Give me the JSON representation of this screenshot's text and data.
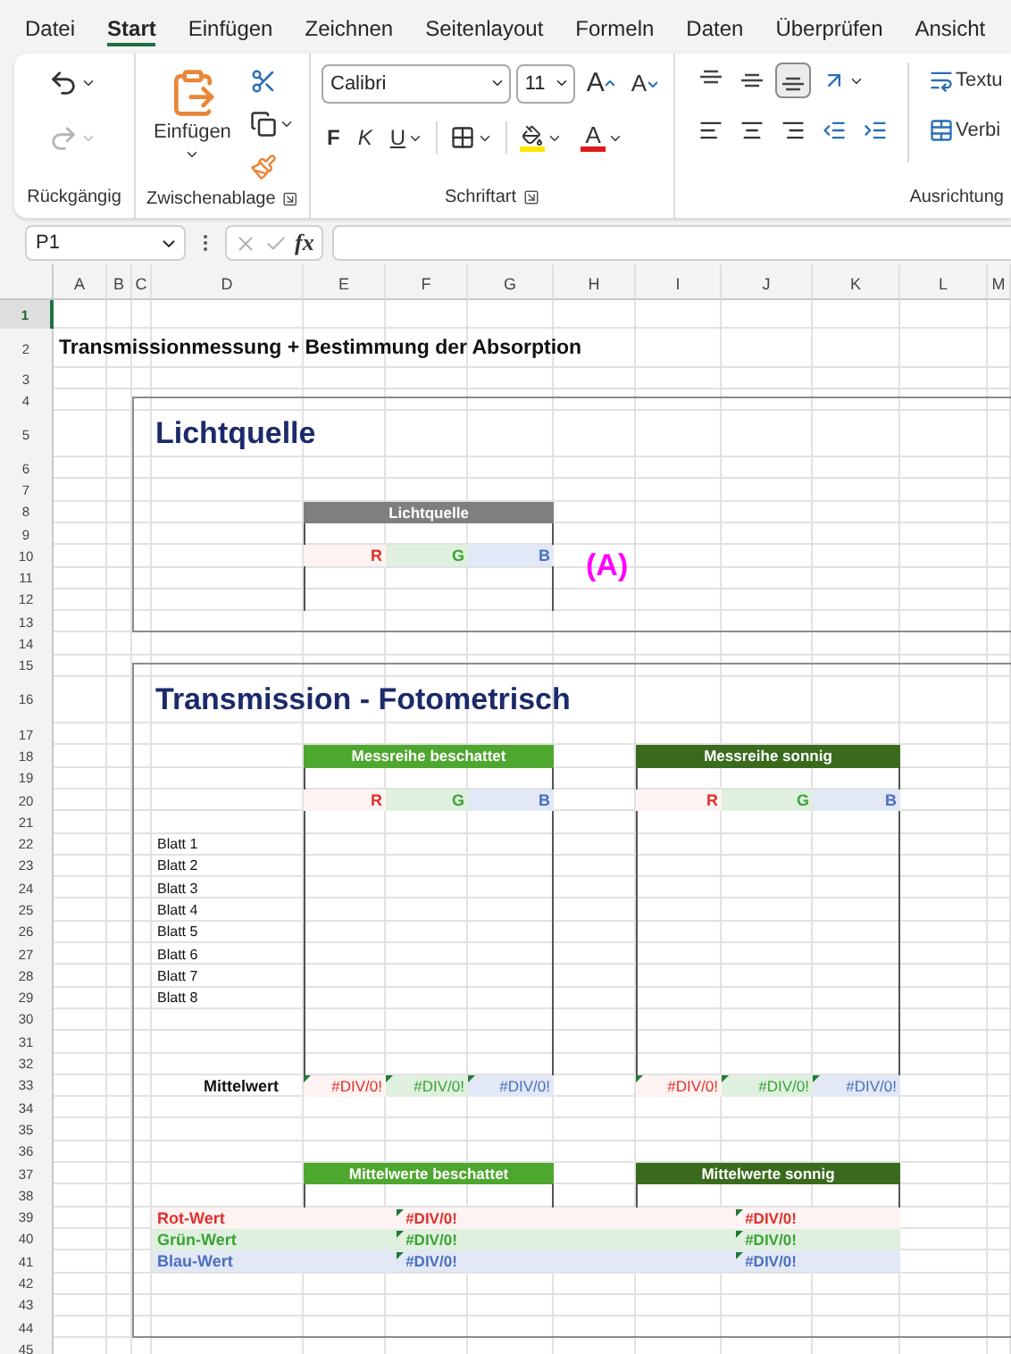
{
  "menu": [
    {
      "label": "Datei",
      "selected": false
    },
    {
      "label": "Start",
      "selected": true
    },
    {
      "label": "Einfügen",
      "selected": false
    },
    {
      "label": "Zeichnen",
      "selected": false
    },
    {
      "label": "Seitenlayout",
      "selected": false
    },
    {
      "label": "Formeln",
      "selected": false
    },
    {
      "label": "Daten",
      "selected": false
    },
    {
      "label": "Überprüfen",
      "selected": false
    },
    {
      "label": "Ansicht",
      "selected": false
    }
  ],
  "ribbon": {
    "redo_disabled": true,
    "paste_label": "Einfügen",
    "font_name": "Calibri",
    "font_size": "11",
    "grow_font": "A",
    "shrink_font": "A",
    "bold": "F",
    "italic": "K",
    "underline": "U",
    "font_color": "A",
    "wrap_text": "Textu",
    "merge": "Verbi",
    "vertical_align": [
      {
        "kind": "top",
        "selected": false
      },
      {
        "kind": "middle",
        "selected": false
      },
      {
        "kind": "bottom",
        "selected": true
      }
    ],
    "groups": [
      {
        "label": "Rückgängig",
        "launcher": false
      },
      {
        "label": "Zwischenablage",
        "launcher": true
      },
      {
        "label": "Schriftart",
        "launcher": true
      },
      {
        "label": "Ausrichtung",
        "launcher": false
      }
    ]
  },
  "formula_bar": {
    "name_box": "P1",
    "function_label": "fx"
  },
  "sheet": {
    "columns": [
      "A",
      "B",
      "C",
      "D",
      "E",
      "F",
      "G",
      "H",
      "I",
      "J",
      "K",
      "L",
      "M"
    ],
    "rows": [
      {
        "label": "1",
        "selected": true
      },
      {
        "label": "2",
        "selected": false
      },
      {
        "label": "3",
        "selected": false
      },
      {
        "label": "4",
        "selected": false
      },
      {
        "label": "5",
        "selected": false
      },
      {
        "label": "6",
        "selected": false
      },
      {
        "label": "7",
        "selected": false
      },
      {
        "label": "8",
        "selected": false
      },
      {
        "label": "9",
        "selected": false
      },
      {
        "label": "10",
        "selected": false
      },
      {
        "label": "11",
        "selected": false
      },
      {
        "label": "12",
        "selected": false
      },
      {
        "label": "13",
        "selected": false
      },
      {
        "label": "14",
        "selected": false
      },
      {
        "label": "15",
        "selected": false
      },
      {
        "label": "16",
        "selected": false
      },
      {
        "label": "17",
        "selected": false
      },
      {
        "label": "18",
        "selected": false
      },
      {
        "label": "19",
        "selected": false
      },
      {
        "label": "20",
        "selected": false
      },
      {
        "label": "21",
        "selected": false
      },
      {
        "label": "22",
        "selected": false
      },
      {
        "label": "23",
        "selected": false
      },
      {
        "label": "24",
        "selected": false
      },
      {
        "label": "25",
        "selected": false
      },
      {
        "label": "26",
        "selected": false
      },
      {
        "label": "27",
        "selected": false
      },
      {
        "label": "28",
        "selected": false
      },
      {
        "label": "29",
        "selected": false
      },
      {
        "label": "30",
        "selected": false
      },
      {
        "label": "31",
        "selected": false
      },
      {
        "label": "32",
        "selected": false
      },
      {
        "label": "33",
        "selected": false
      },
      {
        "label": "34",
        "selected": false
      },
      {
        "label": "35",
        "selected": false
      },
      {
        "label": "36",
        "selected": false
      },
      {
        "label": "37",
        "selected": false
      },
      {
        "label": "38",
        "selected": false
      },
      {
        "label": "39",
        "selected": false
      },
      {
        "label": "40",
        "selected": false
      },
      {
        "label": "41",
        "selected": false
      },
      {
        "label": "42",
        "selected": false
      },
      {
        "label": "43",
        "selected": false
      },
      {
        "label": "44",
        "selected": false
      },
      {
        "label": "45",
        "selected": false
      }
    ],
    "title": "Transmissionmessung +  Bestimmung der Absorption",
    "light_panel": {
      "heading": "Lichtquelle",
      "table": {
        "header": "Lichtquelle",
        "color": "#7f7f7f"
      },
      "marker": "(A)",
      "channels": [
        {
          "label": "R",
          "color": "#e0302a"
        },
        {
          "label": "G",
          "color": "#3aa335"
        },
        {
          "label": "B",
          "color": "#4a6fc0"
        }
      ]
    },
    "transmission_panel": {
      "heading": "Transmission - Fotometrisch",
      "sheets": [
        "Blatt 1",
        "Blatt 2",
        "Blatt 3",
        "Blatt 4",
        "Blatt 5",
        "Blatt 6",
        "Blatt 7",
        "Blatt 8"
      ],
      "mean_label": "Mittelwert",
      "series": [
        {
          "header": "Messreihe beschattet",
          "color": "#4ea72e",
          "channels": [
            {
              "label": "R",
              "color": "#e0302a"
            },
            {
              "label": "G",
              "color": "#3aa335"
            },
            {
              "label": "B",
              "color": "#4a6fc0"
            }
          ],
          "mean": [
            {
              "text": "#DIV/0!",
              "flagged": true
            },
            {
              "text": "#DIV/0!",
              "flagged": true
            },
            {
              "text": "#DIV/0!",
              "flagged": true
            }
          ]
        },
        {
          "header": "Messreihe sonnig",
          "color": "#3a6b1d",
          "channels": [
            {
              "label": "R",
              "color": "#e0302a"
            },
            {
              "label": "G",
              "color": "#3aa335"
            },
            {
              "label": "B",
              "color": "#4a6fc0"
            }
          ],
          "mean": [
            {
              "text": "#DIV/0!",
              "flagged": true
            },
            {
              "text": "#DIV/0!",
              "flagged": true
            },
            {
              "text": "#DIV/0!",
              "flagged": true
            }
          ]
        }
      ],
      "summary_rows": [
        {
          "label": "Rot-Wert",
          "color": "#e0302a"
        },
        {
          "label": "Grün-Wert",
          "color": "#3aa335"
        },
        {
          "label": "Blau-Wert",
          "color": "#4a6fc0"
        }
      ],
      "summaries": [
        {
          "header": "Mittelwerte beschattet",
          "color": "#4ea72e",
          "values": [
            {
              "text": "#DIV/0!",
              "flagged": true
            },
            {
              "text": "#DIV/0!",
              "flagged": true
            },
            {
              "text": "#DIV/0!",
              "flagged": true
            }
          ]
        },
        {
          "header": "Mittelwerte sonnig",
          "color": "#3a6b1d",
          "values": [
            {
              "text": "#DIV/0!",
              "flagged": true
            },
            {
              "text": "#DIV/0!",
              "flagged": true
            },
            {
              "text": "#DIV/0!",
              "flagged": true
            }
          ]
        }
      ]
    }
  }
}
